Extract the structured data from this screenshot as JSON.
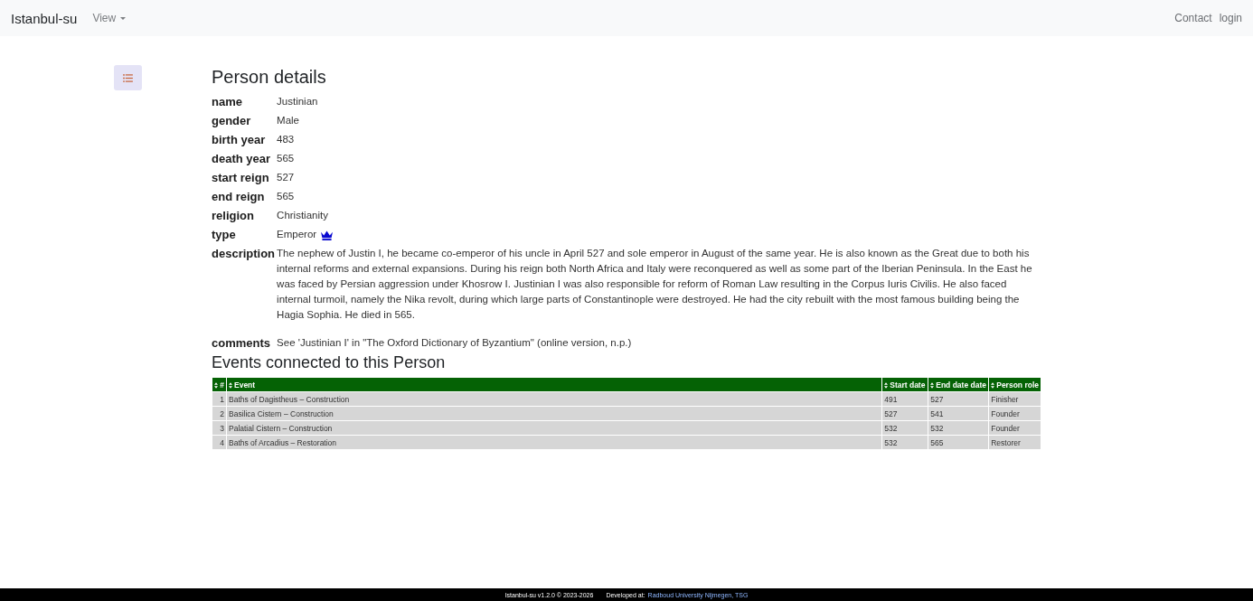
{
  "navbar": {
    "brand": "Istanbul-su",
    "menus": [
      "View"
    ],
    "links": [
      "Contact",
      "login"
    ]
  },
  "person": {
    "title": "Person details",
    "fields": [
      {
        "kind": "text",
        "label": "name",
        "value": "Justinian"
      },
      {
        "kind": "text",
        "label": "gender",
        "value": "Male"
      },
      {
        "kind": "text",
        "label": "birth year",
        "value": "483"
      },
      {
        "kind": "text",
        "label": "death year",
        "value": "565"
      },
      {
        "kind": "text",
        "label": "start reign",
        "value": "527"
      },
      {
        "kind": "text",
        "label": "end reign",
        "value": "565"
      },
      {
        "kind": "text",
        "label": "religion",
        "value": "Christianity"
      },
      {
        "kind": "icon",
        "label": "type",
        "value": "Emperor"
      },
      {
        "kind": "paragraph",
        "label": "description",
        "value": "The nephew of Justin I, he became co-emperor of his uncle in April 527 and sole emperor in August of the same year. He is also known as the Great due to both his internal reforms and external expansions. During his reign both North Africa and Italy were reconquered as well as some part of the Iberian Peninsula. In the East he was faced by Persian aggression under Khosrow I. Justinian I was also responsible for reform of Roman Law resulting in the Corpus Iuris Civilis. He also faced internal turmoil, namely the Nika revolt, during which large parts of Constantinople were destroyed. He had the city rebuilt with the most famous building being the Hagia Sophia. He died in 565."
      },
      {
        "kind": "text",
        "label": "comments",
        "value": "See 'Justinian I' in \"The Oxford Dictionary of Byzantium\" (online version, n.p.)"
      }
    ]
  },
  "events": {
    "title": "Events connected to this Person",
    "columns": [
      "#",
      "Event",
      "Start date",
      "End date date",
      "Person role"
    ],
    "rows": [
      [
        "1",
        "Baths of Dagistheus – Construction",
        "491",
        "527",
        "Finisher"
      ],
      [
        "2",
        "Basilica Cistern – Construction",
        "527",
        "541",
        "Founder"
      ],
      [
        "3",
        "Palatial Cistern – Construction",
        "532",
        "532",
        "Founder"
      ],
      [
        "4",
        "Baths of Arcadius – Restoration",
        "532",
        "565",
        "Restorer"
      ]
    ]
  },
  "footer": {
    "version": "Istanbul-su v1.2.0 © 2023-2026",
    "developed_label": "Developed at:",
    "developer_link": "Radboud University Nijmegen, TSG"
  }
}
